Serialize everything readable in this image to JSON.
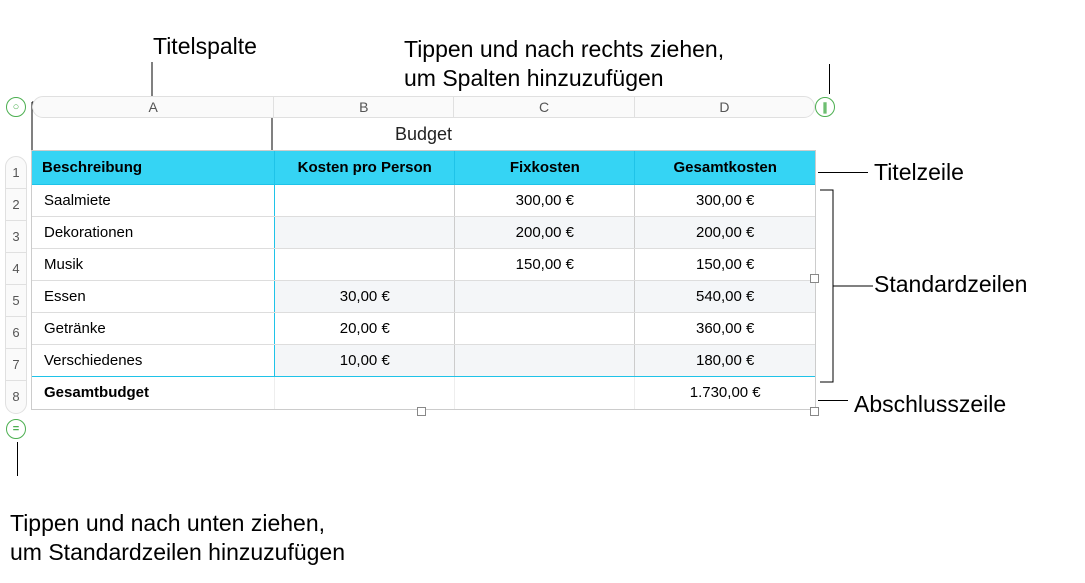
{
  "callouts": {
    "titelspalte": "Titelspalte",
    "add_columns": "Tippen und nach rechts ziehen,\num Spalten hinzuzufügen",
    "titelzeile": "Titelzeile",
    "standardzeilen": "Standardzeilen",
    "abschlusszeile": "Abschlusszeile",
    "add_rows": "Tippen und nach unten ziehen,\num Standardzeilen hinzuzufügen"
  },
  "sheet": {
    "col_letters": [
      "A",
      "B",
      "C",
      "D"
    ],
    "row_numbers": [
      "1",
      "2",
      "3",
      "4",
      "5",
      "6",
      "7",
      "8"
    ],
    "title": "Budget",
    "headers": [
      "Beschreibung",
      "Kosten pro Person",
      "Fixkosten",
      "Gesamtkosten"
    ],
    "rows": [
      {
        "desc": "Saalmiete",
        "per": "",
        "fix": "300,00 €",
        "total": "300,00 €"
      },
      {
        "desc": "Dekorationen",
        "per": "",
        "fix": "200,00 €",
        "total": "200,00 €"
      },
      {
        "desc": "Musik",
        "per": "",
        "fix": "150,00 €",
        "total": "150,00 €"
      },
      {
        "desc": "Essen",
        "per": "30,00 €",
        "fix": "",
        "total": "540,00 €"
      },
      {
        "desc": "Getränke",
        "per": "20,00 €",
        "fix": "",
        "total": "360,00 €"
      },
      {
        "desc": "Verschiedenes",
        "per": "10,00 €",
        "fix": "",
        "total": "180,00 €"
      }
    ],
    "footer": {
      "desc": "Gesamtbudget",
      "per": "",
      "fix": "",
      "total": "1.730,00 €"
    }
  }
}
